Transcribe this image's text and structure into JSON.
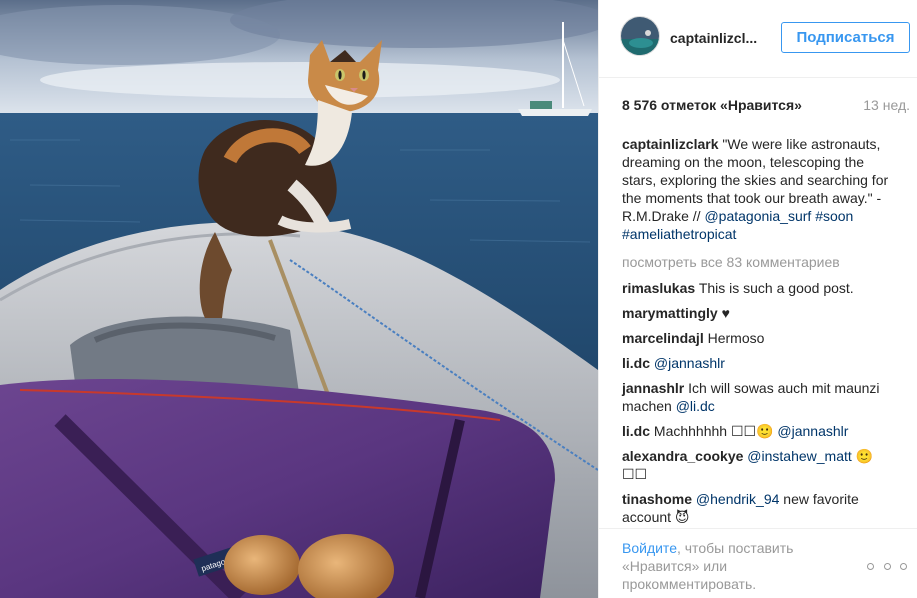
{
  "header": {
    "username": "captainlizcl...",
    "follow_label": "Подписаться"
  },
  "meta": {
    "likes": "8 576 отметок «Нравится»",
    "time": "13 нед."
  },
  "caption": {
    "user": "captainlizclark",
    "text": "\"We were like astronauts, dreaming on the moon, telescoping the stars, exploring the skies and searching for the moments that took our breath away.\" -R.M.Drake // ",
    "mention": "@patagonia_surf",
    "tag1": "#soon",
    "tag2": "#ameliathetropicat"
  },
  "view_all": "посмотреть все 83 комментариев",
  "comments": [
    {
      "user": "rimaslukas",
      "text": "This is such a good post."
    },
    {
      "user": "marymattingly",
      "text": "♥"
    },
    {
      "user": "marcelindajl",
      "text": "Hermoso"
    },
    {
      "user": "li.dc",
      "text": "",
      "mention": "@jannashlr"
    },
    {
      "user": "jannashlr",
      "text": "Ich will sowas auch mit maunzi machen ",
      "mention": "@li.dc"
    },
    {
      "user": "li.dc",
      "text": "Machhhhhh ☐☐🙂 ",
      "mention": "@jannashlr"
    },
    {
      "user": "alexandra_cookye",
      "text": "",
      "mention": "@instahew_matt",
      "after": " 🙂 ☐☐"
    },
    {
      "user": "tinashome",
      "text": "",
      "mention": "@hendrik_94",
      "after": " new favorite account 😈"
    }
  ],
  "footer": {
    "login_link": "Войдите",
    "login_text": ", чтобы поставить «Нравится» или прокомментировать."
  },
  "photo": {
    "bag_brand": "patagonia"
  },
  "colors": {
    "accent": "#3897f0",
    "link": "#003569",
    "muted": "#999999"
  }
}
